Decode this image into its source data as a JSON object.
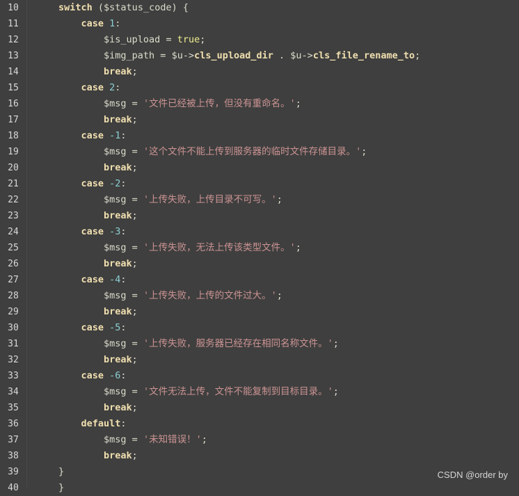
{
  "editor": {
    "lines": [
      {
        "n": "10",
        "segs": [
          [
            "kw",
            "switch"
          ],
          [
            "op",
            " ("
          ],
          [
            "var",
            "$status_code"
          ],
          [
            "op",
            ") {"
          ]
        ]
      },
      {
        "n": "11",
        "segs": [
          [
            "kw",
            "    case "
          ],
          [
            "num",
            "1"
          ],
          [
            "op",
            ":"
          ]
        ]
      },
      {
        "n": "12",
        "segs": [
          [
            "var",
            "        $is_upload"
          ],
          [
            "op",
            " = "
          ],
          [
            "const",
            "true"
          ],
          [
            "op",
            ";"
          ]
        ]
      },
      {
        "n": "13",
        "segs": [
          [
            "var",
            "        $img_path"
          ],
          [
            "op",
            " = "
          ],
          [
            "var",
            "$u"
          ],
          [
            "op",
            "->"
          ],
          [
            "prop",
            "cls_upload_dir"
          ],
          [
            "op",
            " . "
          ],
          [
            "var",
            "$u"
          ],
          [
            "op",
            "->"
          ],
          [
            "prop",
            "cls_file_rename_to"
          ],
          [
            "op",
            ";"
          ]
        ]
      },
      {
        "n": "14",
        "segs": [
          [
            "kw",
            "        break"
          ],
          [
            "op",
            ";"
          ]
        ]
      },
      {
        "n": "15",
        "segs": [
          [
            "kw",
            "    case "
          ],
          [
            "num",
            "2"
          ],
          [
            "op",
            ":"
          ]
        ]
      },
      {
        "n": "16",
        "segs": [
          [
            "var",
            "        $msg"
          ],
          [
            "op",
            " = "
          ],
          [
            "str",
            "'文件已经被上传，但没有重命名。'"
          ],
          [
            "op",
            ";"
          ]
        ]
      },
      {
        "n": "17",
        "segs": [
          [
            "kw",
            "        break"
          ],
          [
            "op",
            ";"
          ]
        ]
      },
      {
        "n": "18",
        "segs": [
          [
            "kw",
            "    case "
          ],
          [
            "num",
            "-1"
          ],
          [
            "op",
            ":"
          ]
        ]
      },
      {
        "n": "19",
        "segs": [
          [
            "var",
            "        $msg"
          ],
          [
            "op",
            " = "
          ],
          [
            "str",
            "'这个文件不能上传到服务器的临时文件存储目录。'"
          ],
          [
            "op",
            ";"
          ]
        ]
      },
      {
        "n": "20",
        "segs": [
          [
            "kw",
            "        break"
          ],
          [
            "op",
            ";"
          ]
        ]
      },
      {
        "n": "21",
        "segs": [
          [
            "kw",
            "    case "
          ],
          [
            "num",
            "-2"
          ],
          [
            "op",
            ":"
          ]
        ]
      },
      {
        "n": "22",
        "segs": [
          [
            "var",
            "        $msg"
          ],
          [
            "op",
            " = "
          ],
          [
            "str",
            "'上传失败，上传目录不可写。'"
          ],
          [
            "op",
            ";"
          ]
        ]
      },
      {
        "n": "23",
        "segs": [
          [
            "kw",
            "        break"
          ],
          [
            "op",
            ";"
          ]
        ]
      },
      {
        "n": "24",
        "segs": [
          [
            "kw",
            "    case "
          ],
          [
            "num",
            "-3"
          ],
          [
            "op",
            ":"
          ]
        ]
      },
      {
        "n": "25",
        "segs": [
          [
            "var",
            "        $msg"
          ],
          [
            "op",
            " = "
          ],
          [
            "str",
            "'上传失败，无法上传该类型文件。'"
          ],
          [
            "op",
            ";"
          ]
        ]
      },
      {
        "n": "26",
        "segs": [
          [
            "kw",
            "        break"
          ],
          [
            "op",
            ";"
          ]
        ]
      },
      {
        "n": "27",
        "segs": [
          [
            "kw",
            "    case "
          ],
          [
            "num",
            "-4"
          ],
          [
            "op",
            ":"
          ]
        ]
      },
      {
        "n": "28",
        "segs": [
          [
            "var",
            "        $msg"
          ],
          [
            "op",
            " = "
          ],
          [
            "str",
            "'上传失败，上传的文件过大。'"
          ],
          [
            "op",
            ";"
          ]
        ]
      },
      {
        "n": "29",
        "segs": [
          [
            "kw",
            "        break"
          ],
          [
            "op",
            ";"
          ]
        ]
      },
      {
        "n": "30",
        "segs": [
          [
            "kw",
            "    case "
          ],
          [
            "num",
            "-5"
          ],
          [
            "op",
            ":"
          ]
        ]
      },
      {
        "n": "31",
        "segs": [
          [
            "var",
            "        $msg"
          ],
          [
            "op",
            " = "
          ],
          [
            "str",
            "'上传失败，服务器已经存在相同名称文件。'"
          ],
          [
            "op",
            ";"
          ]
        ]
      },
      {
        "n": "32",
        "segs": [
          [
            "kw",
            "        break"
          ],
          [
            "op",
            ";"
          ]
        ]
      },
      {
        "n": "33",
        "segs": [
          [
            "kw",
            "    case "
          ],
          [
            "num",
            "-6"
          ],
          [
            "op",
            ":"
          ]
        ]
      },
      {
        "n": "34",
        "segs": [
          [
            "var",
            "        $msg"
          ],
          [
            "op",
            " = "
          ],
          [
            "str",
            "'文件无法上传，文件不能复制到目标目录。'"
          ],
          [
            "op",
            ";"
          ]
        ]
      },
      {
        "n": "35",
        "segs": [
          [
            "kw",
            "        break"
          ],
          [
            "op",
            ";"
          ]
        ]
      },
      {
        "n": "36",
        "segs": [
          [
            "kw",
            "    default"
          ],
          [
            "op",
            ":"
          ]
        ]
      },
      {
        "n": "37",
        "segs": [
          [
            "var",
            "        $msg"
          ],
          [
            "op",
            " = "
          ],
          [
            "str",
            "'未知错误！'"
          ],
          [
            "op",
            ";"
          ]
        ]
      },
      {
        "n": "38",
        "segs": [
          [
            "kw",
            "        break"
          ],
          [
            "op",
            ";"
          ]
        ]
      },
      {
        "n": "39",
        "segs": [
          [
            "op",
            "}"
          ]
        ]
      },
      {
        "n": "40",
        "segs": [
          [
            "op",
            "}"
          ]
        ]
      }
    ]
  },
  "watermark": "CSDN @order by"
}
